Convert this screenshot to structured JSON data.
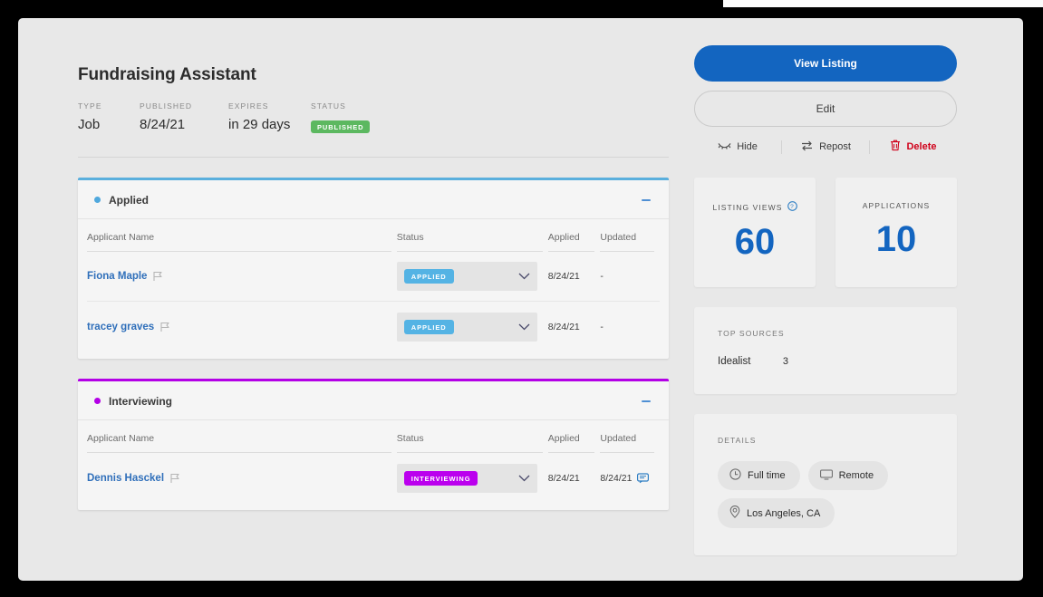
{
  "header": {
    "title": "Fundraising Assistant",
    "meta": [
      {
        "label": "TYPE",
        "value": "Job"
      },
      {
        "label": "PUBLISHED",
        "value": "8/24/21"
      },
      {
        "label": "EXPIRES",
        "value": "in 29 days"
      },
      {
        "label": "STATUS",
        "value": "PUBLISHED"
      }
    ]
  },
  "columns": {
    "name": "Applicant Name",
    "status": "Status",
    "applied": "Applied",
    "updated": "Updated"
  },
  "sections": [
    {
      "title": "Applied",
      "accent": "#5aafdd",
      "rows": [
        {
          "name": "Fiona Maple",
          "status": "APPLIED",
          "applied": "8/24/21",
          "updated": "-",
          "has_comment": false
        },
        {
          "name": "tracey graves",
          "status": "APPLIED",
          "applied": "8/24/21",
          "updated": "-",
          "has_comment": false
        }
      ]
    },
    {
      "title": "Interviewing",
      "accent": "#b300e6",
      "rows": [
        {
          "name": "Dennis Hasckel",
          "status": "INTERVIEWING",
          "applied": "8/24/21",
          "updated": "8/24/21",
          "has_comment": true
        }
      ]
    }
  ],
  "sidebar": {
    "view_listing": "View Listing",
    "edit": "Edit",
    "actions": [
      {
        "label": "Hide",
        "icon": "eye-off-icon"
      },
      {
        "label": "Repost",
        "icon": "repost-icon"
      },
      {
        "label": "Delete",
        "icon": "trash-icon"
      }
    ],
    "stats": [
      {
        "label": "LISTING VIEWS",
        "value": "60",
        "info": true
      },
      {
        "label": "APPLICATIONS",
        "value": "10",
        "info": false
      }
    ],
    "top_sources": {
      "label": "TOP SOURCES",
      "rows": [
        {
          "name": "Idealist",
          "count": "3"
        }
      ]
    },
    "details": {
      "label": "DETAILS",
      "chips": [
        {
          "label": "Full time",
          "icon": "clock-icon"
        },
        {
          "label": "Remote",
          "icon": "monitor-icon"
        },
        {
          "label": "Los Angeles, CA",
          "icon": "map-pin-icon"
        }
      ]
    }
  },
  "colors": {
    "primary_blue": "#1365c0",
    "applied_blue": "#54b3e4",
    "interviewing_purple": "#bb00ee",
    "published_green": "#5cb860",
    "delete_red": "#d0021b"
  }
}
